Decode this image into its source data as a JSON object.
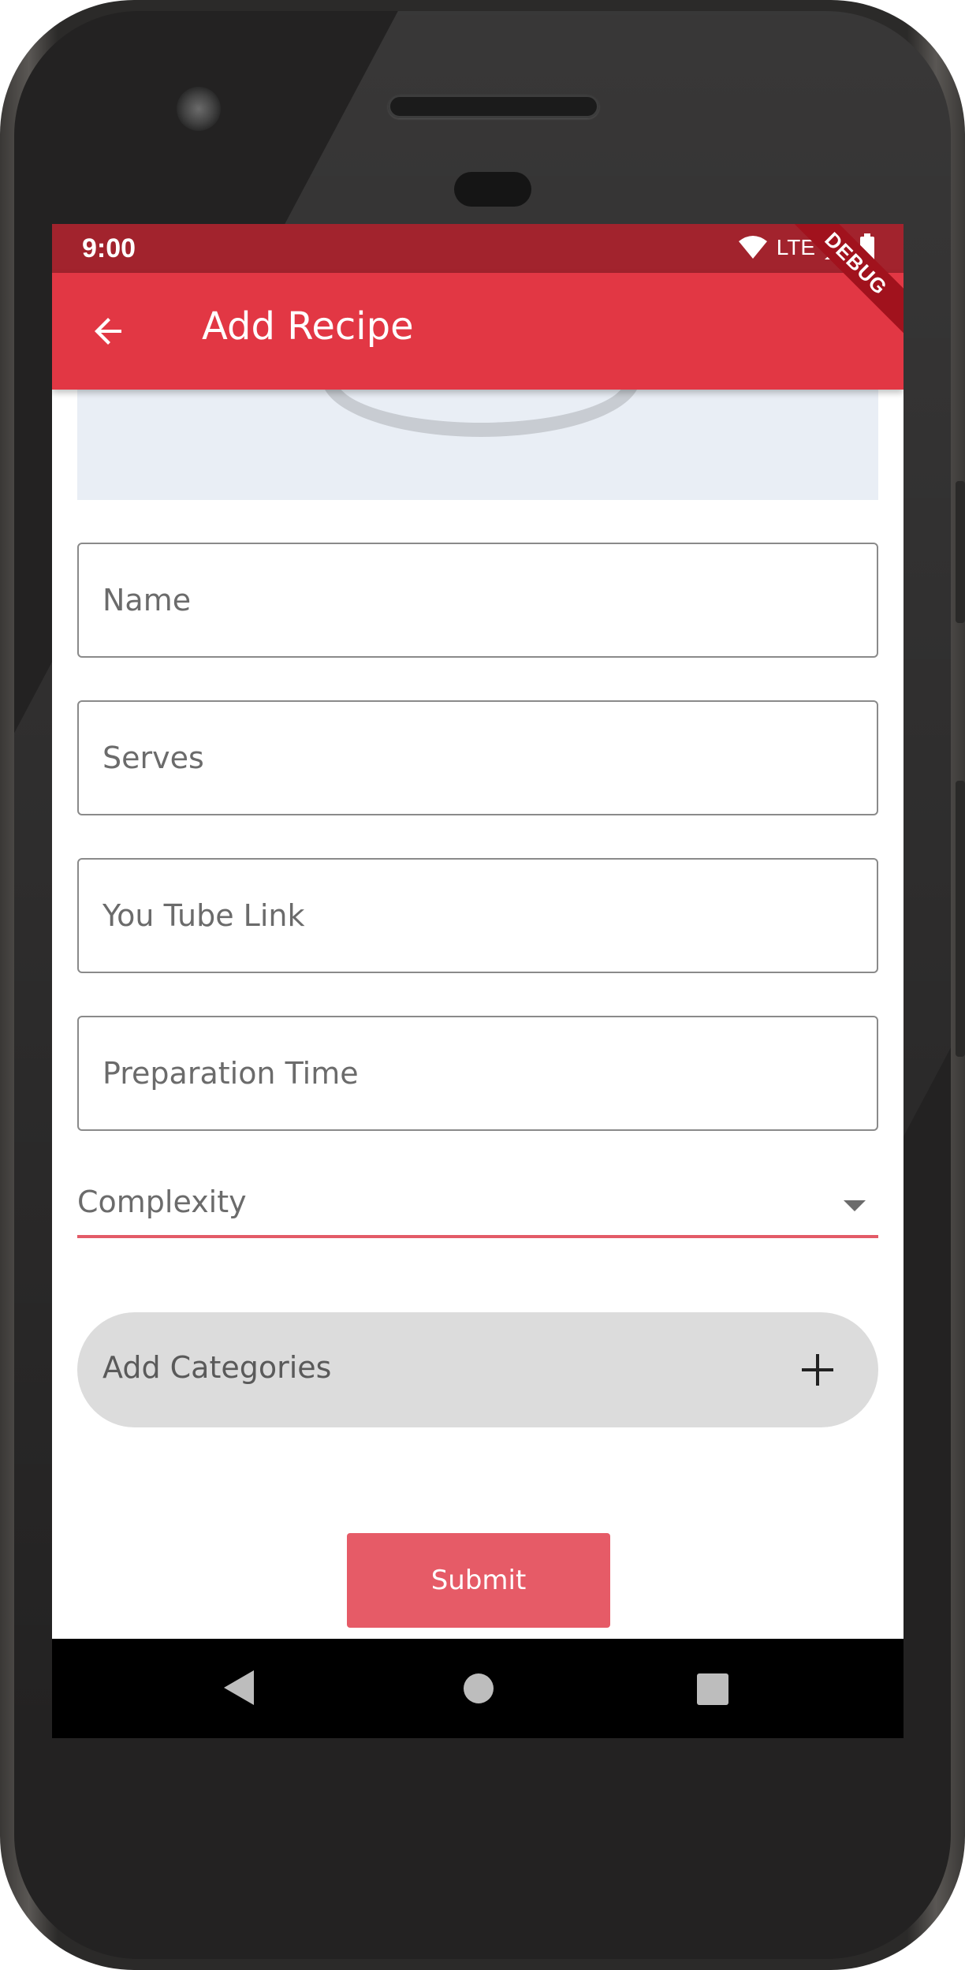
{
  "status_bar": {
    "time": "9:00",
    "network": "LTE",
    "icons": [
      "wifi-icon",
      "signal-icon",
      "battery-icon"
    ]
  },
  "app_bar": {
    "title": "Add Recipe",
    "back_icon": "arrow-back-icon",
    "debug_banner": "DEBUG",
    "color": "#e23744"
  },
  "form": {
    "name_placeholder": "Name",
    "serves_placeholder": "Serves",
    "youtube_placeholder": "You Tube Link",
    "prep_time_placeholder": "Preparation Time",
    "complexity_label": "Complexity",
    "add_categories_label": "Add Categories",
    "add_categories_icon": "plus-icon",
    "submit_label": "Submit",
    "submit_color": "#e65b67"
  },
  "nav_bar": {
    "icons": [
      "nav-back-icon",
      "nav-home-icon",
      "nav-recents-icon"
    ]
  }
}
